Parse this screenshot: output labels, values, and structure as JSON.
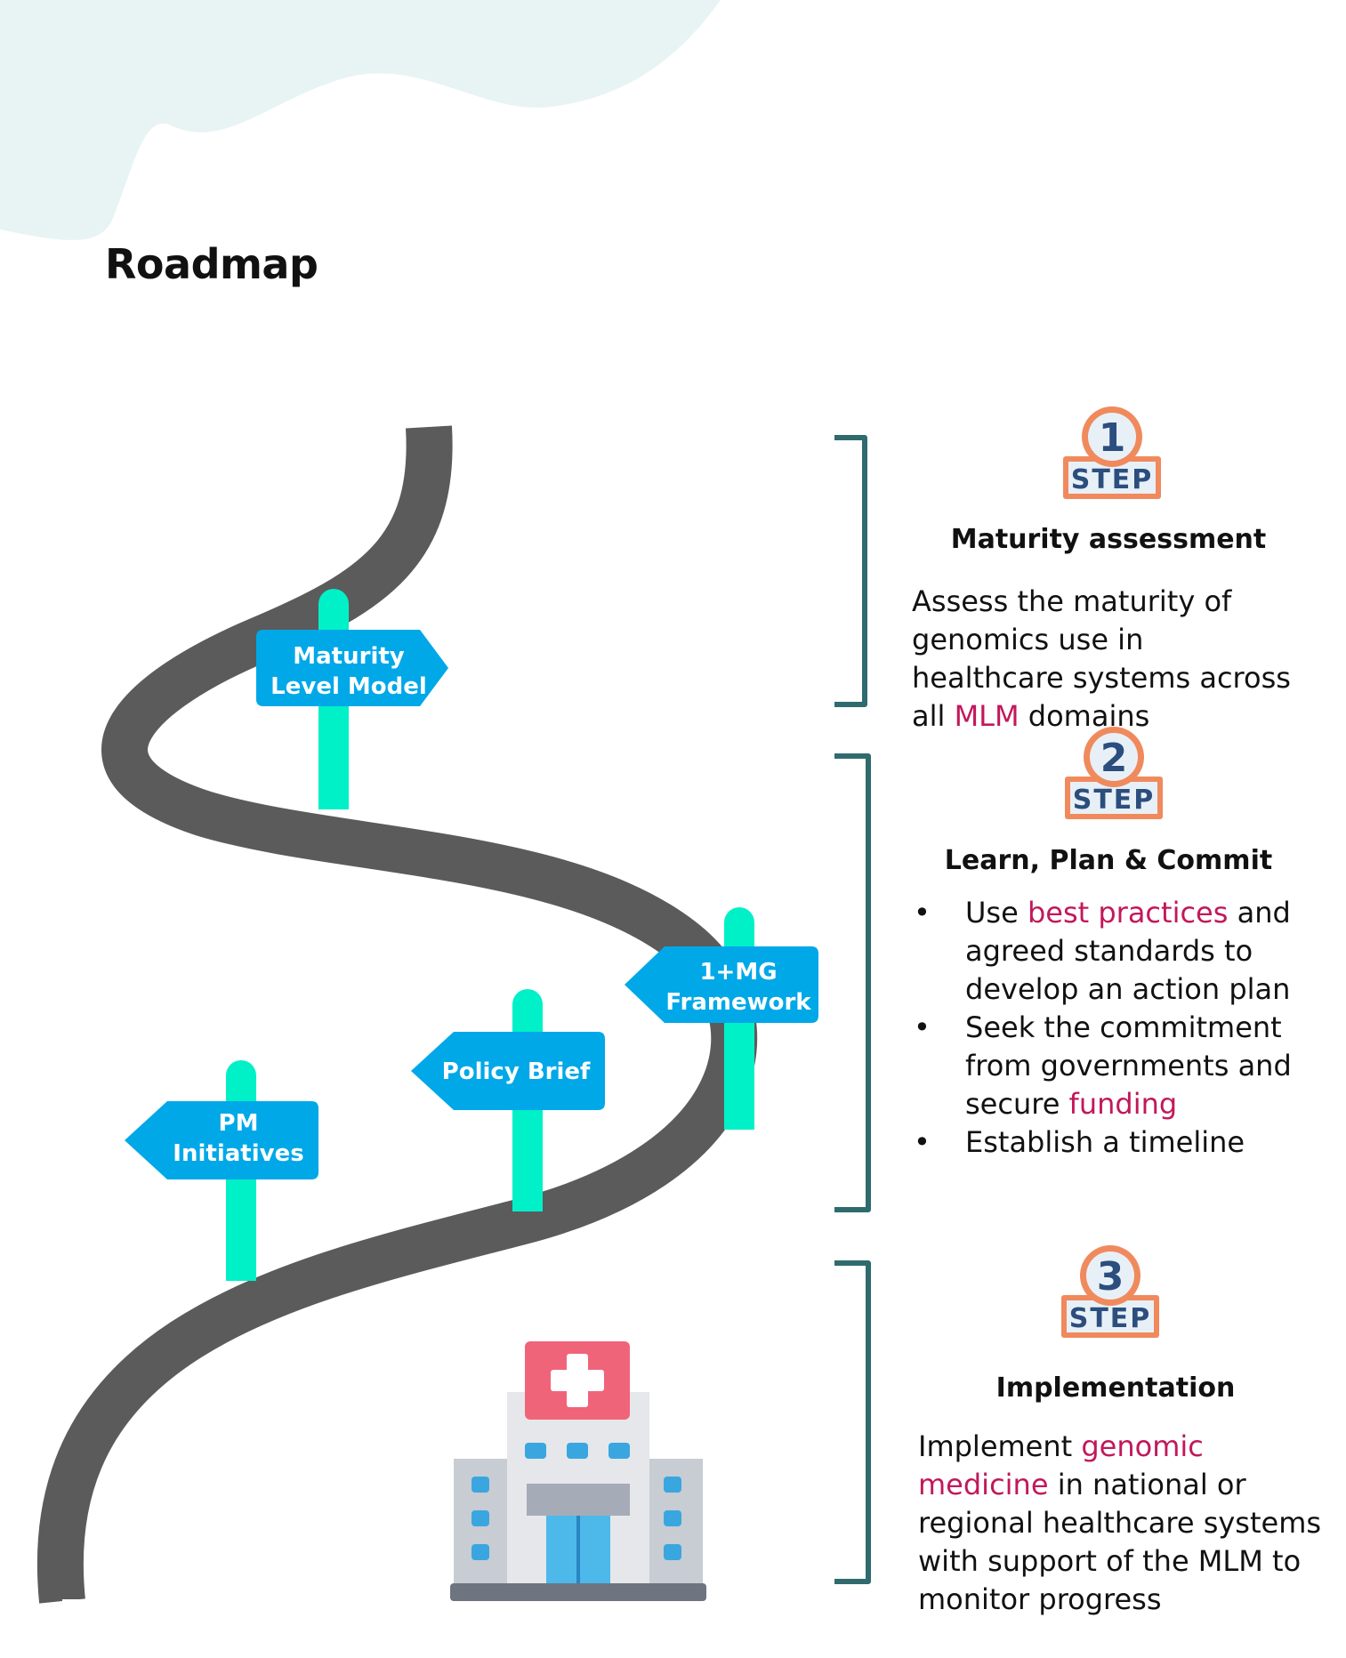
{
  "page": {
    "title": "Roadmap"
  },
  "signposts": [
    {
      "line1": "Maturity",
      "line2": "Level Model"
    },
    {
      "line1": "1+MG",
      "line2": "Framework"
    },
    {
      "line1": "Policy Brief",
      "line2": ""
    },
    {
      "line1": "PM",
      "line2": "Initiatives"
    }
  ],
  "steps": [
    {
      "number": "1",
      "badge": "STEP",
      "title": "Maturity assessment",
      "text_before": "Assess the maturity of genomics use in healthcare systems across all ",
      "text_highlight": "MLM",
      "text_after": " domains"
    },
    {
      "number": "2",
      "badge": "STEP",
      "title": "Learn, Plan & Commit",
      "bullets": [
        {
          "before": "Use ",
          "highlight": "best practices",
          "after": " and agreed standards to develop an action plan"
        },
        {
          "before": "Seek the commitment from governments and secure ",
          "highlight": "funding",
          "after": ""
        },
        {
          "before": "Establish a timeline",
          "highlight": "",
          "after": ""
        }
      ]
    },
    {
      "number": "3",
      "badge": "STEP",
      "title": "Implementation",
      "text_before": "Implement ",
      "text_highlight": "genomic medicine",
      "text_after": " in national or regional healthcare systems with support of the MLM to monitor progress"
    }
  ],
  "colors": {
    "road": "#5b5b5b",
    "sign": "#00a8e8",
    "post": "#00f0c8",
    "bracket": "#2f6b6e",
    "highlight": "#c2185b",
    "step_orange": "#f08a5d",
    "step_navy": "#2b4e7e",
    "hospital_red": "#f0647a",
    "background_blob": "#e8f4f4"
  }
}
